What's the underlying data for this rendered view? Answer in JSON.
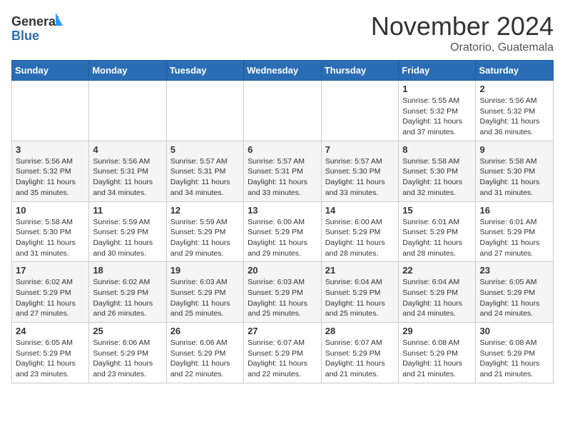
{
  "logo": {
    "general": "General",
    "blue": "Blue"
  },
  "header": {
    "month": "November 2024",
    "location": "Oratorio, Guatemala"
  },
  "weekdays": [
    "Sunday",
    "Monday",
    "Tuesday",
    "Wednesday",
    "Thursday",
    "Friday",
    "Saturday"
  ],
  "weeks": [
    [
      {
        "day": "",
        "info": ""
      },
      {
        "day": "",
        "info": ""
      },
      {
        "day": "",
        "info": ""
      },
      {
        "day": "",
        "info": ""
      },
      {
        "day": "",
        "info": ""
      },
      {
        "day": "1",
        "info": "Sunrise: 5:55 AM\nSunset: 5:32 PM\nDaylight: 11 hours and 37 minutes."
      },
      {
        "day": "2",
        "info": "Sunrise: 5:56 AM\nSunset: 5:32 PM\nDaylight: 11 hours and 36 minutes."
      }
    ],
    [
      {
        "day": "3",
        "info": "Sunrise: 5:56 AM\nSunset: 5:32 PM\nDaylight: 11 hours and 35 minutes."
      },
      {
        "day": "4",
        "info": "Sunrise: 5:56 AM\nSunset: 5:31 PM\nDaylight: 11 hours and 34 minutes."
      },
      {
        "day": "5",
        "info": "Sunrise: 5:57 AM\nSunset: 5:31 PM\nDaylight: 11 hours and 34 minutes."
      },
      {
        "day": "6",
        "info": "Sunrise: 5:57 AM\nSunset: 5:31 PM\nDaylight: 11 hours and 33 minutes."
      },
      {
        "day": "7",
        "info": "Sunrise: 5:57 AM\nSunset: 5:30 PM\nDaylight: 11 hours and 33 minutes."
      },
      {
        "day": "8",
        "info": "Sunrise: 5:58 AM\nSunset: 5:30 PM\nDaylight: 11 hours and 32 minutes."
      },
      {
        "day": "9",
        "info": "Sunrise: 5:58 AM\nSunset: 5:30 PM\nDaylight: 11 hours and 31 minutes."
      }
    ],
    [
      {
        "day": "10",
        "info": "Sunrise: 5:58 AM\nSunset: 5:30 PM\nDaylight: 11 hours and 31 minutes."
      },
      {
        "day": "11",
        "info": "Sunrise: 5:59 AM\nSunset: 5:29 PM\nDaylight: 11 hours and 30 minutes."
      },
      {
        "day": "12",
        "info": "Sunrise: 5:59 AM\nSunset: 5:29 PM\nDaylight: 11 hours and 29 minutes."
      },
      {
        "day": "13",
        "info": "Sunrise: 6:00 AM\nSunset: 5:29 PM\nDaylight: 11 hours and 29 minutes."
      },
      {
        "day": "14",
        "info": "Sunrise: 6:00 AM\nSunset: 5:29 PM\nDaylight: 11 hours and 28 minutes."
      },
      {
        "day": "15",
        "info": "Sunrise: 6:01 AM\nSunset: 5:29 PM\nDaylight: 11 hours and 28 minutes."
      },
      {
        "day": "16",
        "info": "Sunrise: 6:01 AM\nSunset: 5:29 PM\nDaylight: 11 hours and 27 minutes."
      }
    ],
    [
      {
        "day": "17",
        "info": "Sunrise: 6:02 AM\nSunset: 5:29 PM\nDaylight: 11 hours and 27 minutes."
      },
      {
        "day": "18",
        "info": "Sunrise: 6:02 AM\nSunset: 5:29 PM\nDaylight: 11 hours and 26 minutes."
      },
      {
        "day": "19",
        "info": "Sunrise: 6:03 AM\nSunset: 5:29 PM\nDaylight: 11 hours and 25 minutes."
      },
      {
        "day": "20",
        "info": "Sunrise: 6:03 AM\nSunset: 5:29 PM\nDaylight: 11 hours and 25 minutes."
      },
      {
        "day": "21",
        "info": "Sunrise: 6:04 AM\nSunset: 5:29 PM\nDaylight: 11 hours and 25 minutes."
      },
      {
        "day": "22",
        "info": "Sunrise: 6:04 AM\nSunset: 5:29 PM\nDaylight: 11 hours and 24 minutes."
      },
      {
        "day": "23",
        "info": "Sunrise: 6:05 AM\nSunset: 5:29 PM\nDaylight: 11 hours and 24 minutes."
      }
    ],
    [
      {
        "day": "24",
        "info": "Sunrise: 6:05 AM\nSunset: 5:29 PM\nDaylight: 11 hours and 23 minutes."
      },
      {
        "day": "25",
        "info": "Sunrise: 6:06 AM\nSunset: 5:29 PM\nDaylight: 11 hours and 23 minutes."
      },
      {
        "day": "26",
        "info": "Sunrise: 6:06 AM\nSunset: 5:29 PM\nDaylight: 11 hours and 22 minutes."
      },
      {
        "day": "27",
        "info": "Sunrise: 6:07 AM\nSunset: 5:29 PM\nDaylight: 11 hours and 22 minutes."
      },
      {
        "day": "28",
        "info": "Sunrise: 6:07 AM\nSunset: 5:29 PM\nDaylight: 11 hours and 21 minutes."
      },
      {
        "day": "29",
        "info": "Sunrise: 6:08 AM\nSunset: 5:29 PM\nDaylight: 11 hours and 21 minutes."
      },
      {
        "day": "30",
        "info": "Sunrise: 6:08 AM\nSunset: 5:29 PM\nDaylight: 11 hours and 21 minutes."
      }
    ]
  ]
}
